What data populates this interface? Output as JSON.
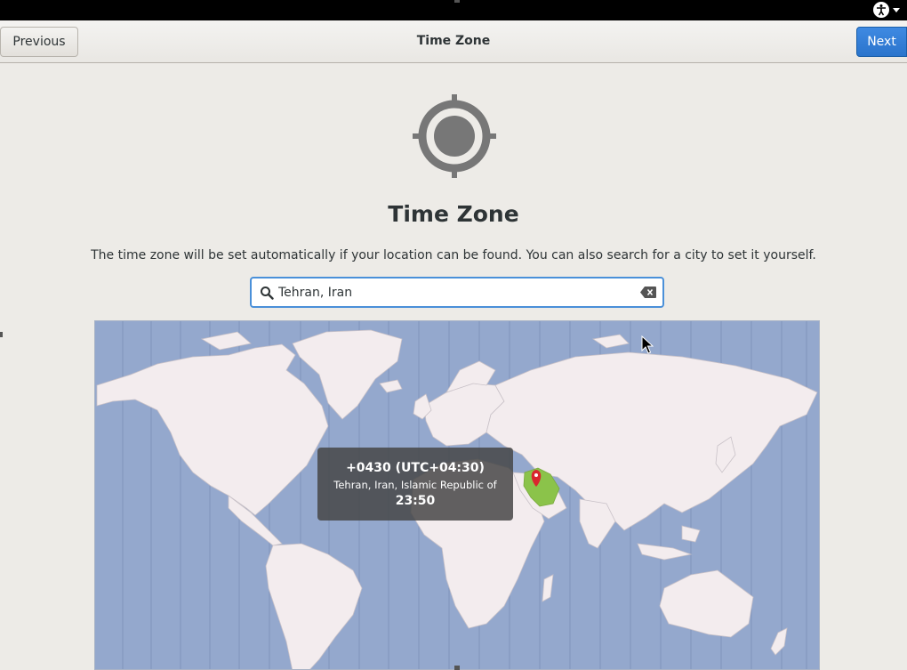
{
  "system_bar": {
    "accessibility_icon": "accessibility-icon",
    "menu_arrow_icon": "chevron-down-icon"
  },
  "header": {
    "previous_label": "Previous",
    "title": "Time Zone",
    "next_label": "Next"
  },
  "main": {
    "icon": "location-target-icon",
    "title": "Time Zone",
    "description": "The time zone will be set automatically if your location can be found. You can also search for a city to set it yourself."
  },
  "search": {
    "value": "Tehran, Iran",
    "search_icon": "search-icon",
    "clear_icon": "clear-icon"
  },
  "map": {
    "selected_zone_color": "#8bc34a",
    "pin_color": "#d9262e",
    "tooltip": {
      "offset": "+0430 (UTC+04:30)",
      "place": "Tehran, Iran, Islamic Republic of",
      "time": "23:50"
    }
  },
  "colors": {
    "accent": "#2a74cc",
    "ocean": "#94a8cd",
    "land": "#f3ecee"
  }
}
